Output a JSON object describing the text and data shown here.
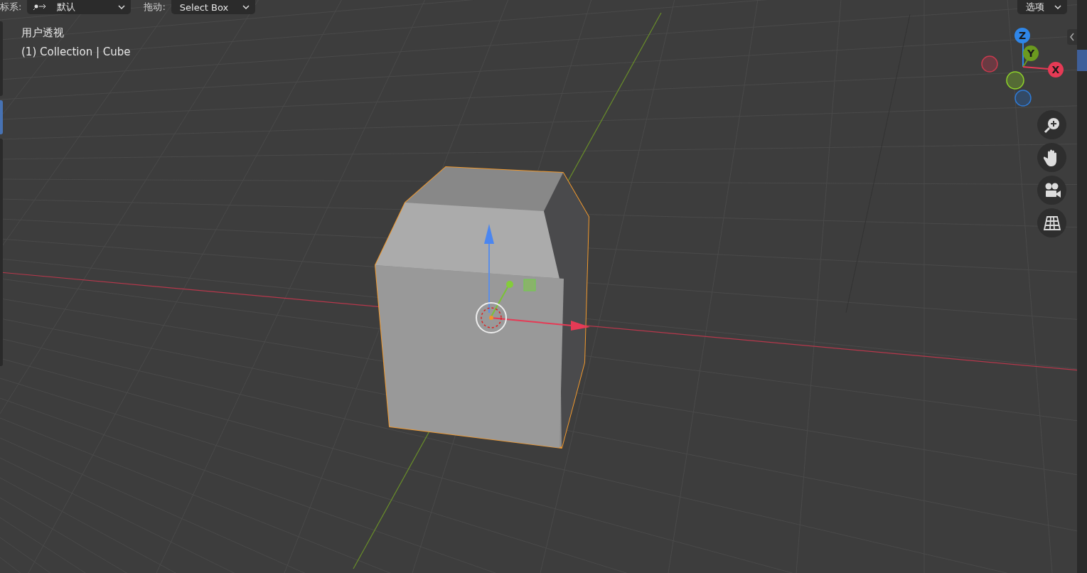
{
  "header": {
    "coordinate_label": "标系:",
    "coordinate_value": "默认",
    "drag_label": "拖动:",
    "drag_value": "Select Box",
    "options": "选项"
  },
  "overlay": {
    "view_name": "用户透视",
    "object_info": "(1) Collection | Cube"
  },
  "axis_gizmo": [
    {
      "label": "Z",
      "color": "#2f86e8"
    },
    {
      "label": "Y",
      "color": "#6b9a1f"
    },
    {
      "label": "X",
      "color": "#e63a55"
    }
  ],
  "nav_buttons": [
    {
      "kind": "zoom"
    },
    {
      "kind": "pan"
    },
    {
      "kind": "camera"
    },
    {
      "kind": "ortho"
    }
  ]
}
